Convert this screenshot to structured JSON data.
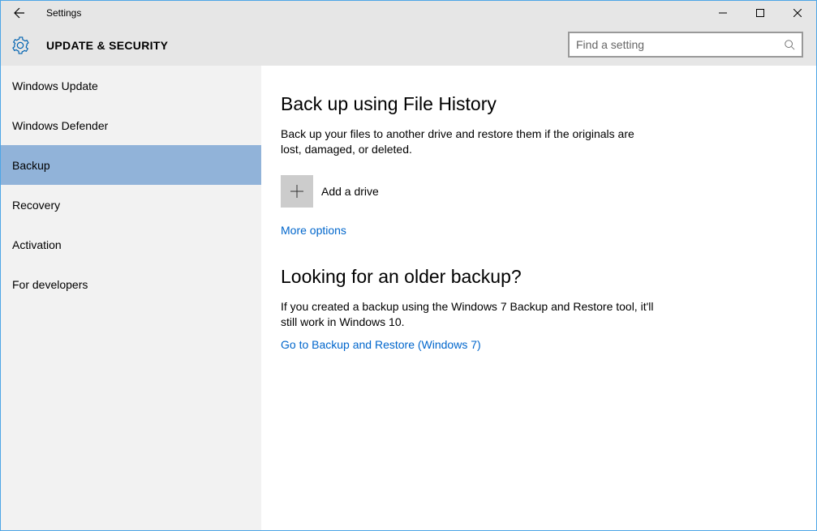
{
  "titlebar": {
    "title": "Settings"
  },
  "header": {
    "section_title": "UPDATE & SECURITY",
    "search_placeholder": "Find a setting"
  },
  "sidebar": {
    "items": [
      {
        "label": "Windows Update"
      },
      {
        "label": "Windows Defender"
      },
      {
        "label": "Backup"
      },
      {
        "label": "Recovery"
      },
      {
        "label": "Activation"
      },
      {
        "label": "For developers"
      }
    ]
  },
  "main": {
    "section1": {
      "title": "Back up using File History",
      "desc": "Back up your files to another drive and restore them if the originals are lost, damaged, or deleted.",
      "add_drive_label": "Add a drive",
      "more_options": "More options"
    },
    "section2": {
      "title": "Looking for an older backup?",
      "desc": "If you created a backup using the Windows 7 Backup and Restore tool, it'll still work in Windows 10.",
      "link": "Go to Backup and Restore (Windows 7)"
    }
  }
}
